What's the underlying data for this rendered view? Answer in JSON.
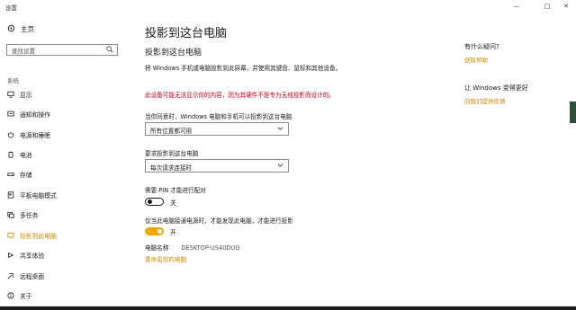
{
  "window": {
    "title": "设置",
    "minimize": "—",
    "maximize": "□",
    "close": "✕"
  },
  "sidebar": {
    "home": {
      "label": "主页",
      "icon": "home-icon"
    },
    "search_placeholder": "查找设置",
    "section": "系统",
    "items": [
      {
        "label": "显示",
        "icon": "display-icon"
      },
      {
        "label": "通知和操作",
        "icon": "notifications-icon"
      },
      {
        "label": "电源和睡眠",
        "icon": "power-icon"
      },
      {
        "label": "电池",
        "icon": "battery-icon"
      },
      {
        "label": "存储",
        "icon": "storage-icon"
      },
      {
        "label": "平板电脑模式",
        "icon": "tablet-mode-icon"
      },
      {
        "label": "多任务",
        "icon": "multitasking-icon"
      },
      {
        "label": "投影到此电脑",
        "icon": "project-icon",
        "active": true
      },
      {
        "label": "共享体验",
        "icon": "shared-experiences-icon"
      },
      {
        "label": "远程桌面",
        "icon": "remote-desktop-icon"
      },
      {
        "label": "关于",
        "icon": "about-icon"
      }
    ]
  },
  "main": {
    "title": "投影到这台电脑",
    "subtitle": "投影到这台电脑",
    "description": "将 Windows 手机或电脑投影到此屏幕，并使用其键盘、鼠标和其他设备。",
    "warning": "此设备可能无法显示你的内容，因为其硬件不是专为无线投影而设计的。",
    "availability": {
      "label": "当你同意时，Windows 电脑和手机可以投影到这台电脑",
      "value": "所有位置都可用"
    },
    "ask": {
      "label": "要求投影到这台电脑",
      "value": "每次请求连接时"
    },
    "pin": {
      "label": "需要 PIN 才能进行配对",
      "state": "关"
    },
    "power": {
      "label": "仅当此电脑接通电源时，才能发现此电脑，才能进行投影",
      "state": "开"
    },
    "pc_name": {
      "label": "电脑名称",
      "value": "DESKTOP-US40DUG"
    },
    "rename": "重命名你的电脑"
  },
  "right": {
    "question": "有什么疑问?",
    "help": "获取帮助",
    "better": "让 Windows 变得更好",
    "feedback": "向我们提供反馈"
  },
  "colors": {
    "accent": "#d08a00",
    "toggle_on": "#f0a800",
    "warning": "#c4001a"
  }
}
